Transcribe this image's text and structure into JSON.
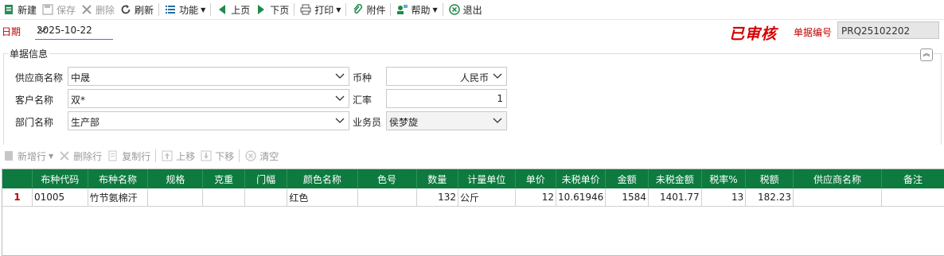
{
  "toolbar": {
    "new": "新建",
    "save": "保存",
    "delete": "删除",
    "refresh": "刷新",
    "function": "功能",
    "prev": "上页",
    "next": "下页",
    "print": "打印",
    "attachment": "附件",
    "help": "帮助",
    "exit": "退出"
  },
  "header": {
    "date_label": "日期",
    "date_value": "2025-10-22",
    "status": "已审核",
    "docno_label": "单据编号",
    "docno_value": "PRQ25102202"
  },
  "form": {
    "group_title": "单据信息",
    "supplier_label": "供应商名称",
    "supplier_value": "中晟",
    "currency_label": "币种",
    "currency_value": "人民币",
    "customer_label": "客户名称",
    "customer_value": "双*",
    "rate_label": "汇率",
    "rate_value": "1",
    "dept_label": "部门名称",
    "dept_value": "生产部",
    "salesman_label": "业务员",
    "salesman_value": "侯梦旋"
  },
  "rowbar": {
    "add_row": "新增行",
    "delete_row": "删除行",
    "copy_row": "复制行",
    "move_up": "上移",
    "move_down": "下移",
    "clear": "清空"
  },
  "grid": {
    "columns": [
      "",
      "布种代码",
      "布种名称",
      "规格",
      "克重",
      "门幅",
      "颜色名称",
      "色号",
      "数量",
      "计量单位",
      "单价",
      "未税单价",
      "金额",
      "未税金额",
      "税率%",
      "税额",
      "供应商名称",
      "备注"
    ],
    "rows": [
      [
        "1",
        "01005",
        "竹节氨棉汗",
        "",
        "",
        "",
        "红色",
        "",
        "132",
        "公斤",
        "12",
        "10.61946",
        "1584",
        "1401.77",
        "13",
        "182.23",
        "",
        ""
      ]
    ]
  },
  "colors": {
    "header_green": "#0e7a3f",
    "status_red": "#d40000"
  }
}
